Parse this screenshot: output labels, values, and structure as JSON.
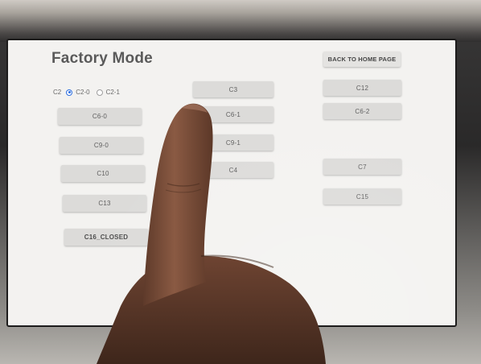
{
  "screen": {
    "title": "Factory Mode",
    "home_button": "BACK TO HOME PAGE",
    "radio_group": {
      "label": "C2",
      "options": [
        {
          "label": "C2-0",
          "selected": true
        },
        {
          "label": "C2-1",
          "selected": false
        }
      ]
    },
    "buttons": {
      "c6_0": "C6-0",
      "c9_0": "C9-0",
      "c10": "C10",
      "c13": "C13",
      "c16_closed": "C16_CLOSED",
      "c3": "C3",
      "c6_1": "C6-1",
      "c9_1": "C9-1",
      "c4": "C4",
      "c12": "C12",
      "c6_2": "C6-2",
      "c7": "C7",
      "c15": "C15"
    }
  },
  "colors": {
    "screen_bg": "#f3f2f0",
    "button_bg": "#dcdbd9",
    "title_text": "#5a5a5a",
    "radio_selected": "#2f6fe0",
    "skin": "#7a4e3a"
  }
}
